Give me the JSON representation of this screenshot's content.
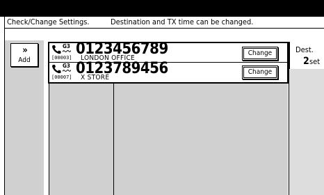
{
  "header": {
    "left_text": "Check/Change Settings.",
    "right_text": "Destination and TX time can be changed."
  },
  "add_button": {
    "arrows": "»",
    "label": "Add"
  },
  "destinations": [
    {
      "line_type": "G3",
      "fax_number": "0123456789",
      "code": "[00003]",
      "name": "LONDON OFFICE",
      "change_label": "Change"
    },
    {
      "line_type": "G3",
      "fax_number": "0123789456",
      "code": "[00007]",
      "name": "X STORE",
      "change_label": "Change"
    }
  ],
  "dest_count": {
    "label": "Dest.",
    "number": "2",
    "unit": "set"
  },
  "icons": {
    "phone": "phone-handset-icon",
    "line": "tilde-wave-icon"
  }
}
